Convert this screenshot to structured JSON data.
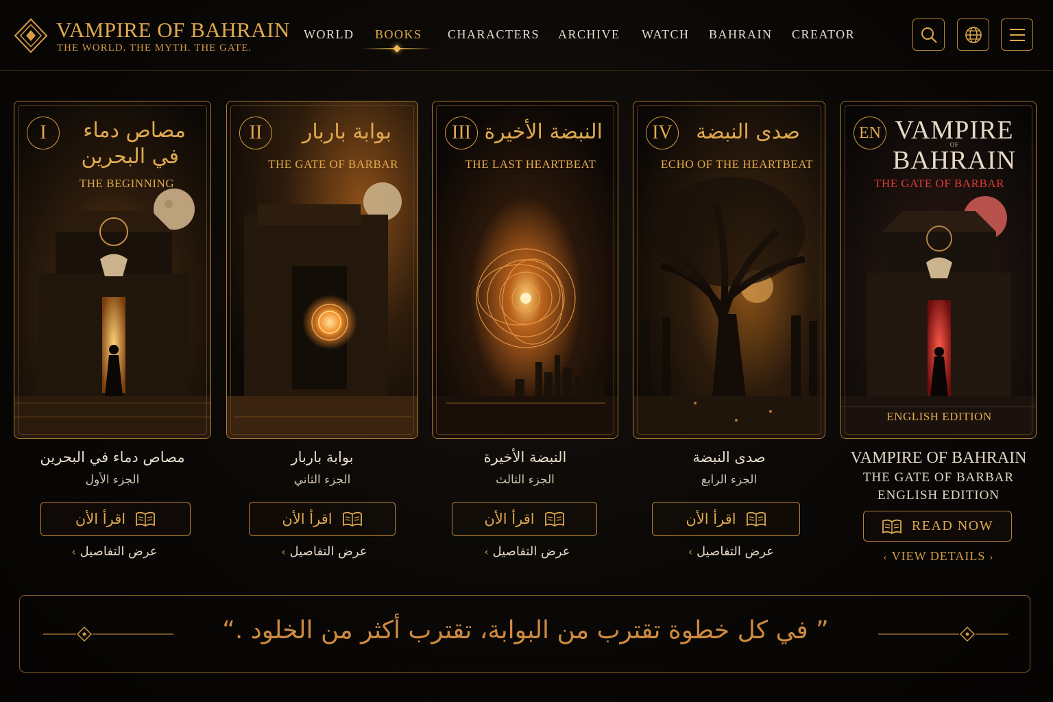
{
  "brand": {
    "title": "VAMPIRE OF BAHRAIN",
    "tagline": "THE WORLD. THE MYTH. THE GATE."
  },
  "nav": {
    "items": [
      {
        "label": "WORLD"
      },
      {
        "label": "BOOKS",
        "active": true
      },
      {
        "label": "CHARACTERS"
      },
      {
        "label": "ARCHIVE"
      },
      {
        "label": "WATCH"
      },
      {
        "label": "BAHRAIN"
      },
      {
        "label": "CREATOR"
      }
    ],
    "icons": [
      "search-icon",
      "globe-icon",
      "menu-icon"
    ]
  },
  "books": [
    {
      "numeral": "I",
      "cover_ar_line1": "مصاص دماء",
      "cover_ar_line2": "في البحرين",
      "cover_en": "THE BEGINNING",
      "title": "مصاص دماء في البحرين",
      "part": "الجزء الأول",
      "read_label": "اقرأ الأن",
      "details_label": "عرض التفاصيل"
    },
    {
      "numeral": "II",
      "cover_ar_line1": "بوابة باربار",
      "cover_en": "THE GATE OF BARBAR",
      "title": "بوابة باربار",
      "part": "الجزء الثاني",
      "read_label": "اقرأ الأن",
      "details_label": "عرض التفاصيل"
    },
    {
      "numeral": "III",
      "cover_ar_line1": "النبضة الأخيرة",
      "cover_en": "THE LAST HEARTBEAT",
      "title": "النبضة الأخيرة",
      "part": "الجزء الثالث",
      "read_label": "اقرأ الأن",
      "details_label": "عرض التفاصيل"
    },
    {
      "numeral": "IV",
      "cover_ar_line1": "صدى النبضة",
      "cover_en": "ECHO OF THE HEARTBEAT",
      "title": "صدى النبضة",
      "part": "الجزء الرابع",
      "read_label": "اقرأ الأن",
      "details_label": "عرض التفاصيل"
    },
    {
      "numeral": "EN",
      "cover_en_line1": "VAMPIRE",
      "cover_of": "OF",
      "cover_en_line2": "BAHRAIN",
      "cover_subtitle": "THE GATE OF BARBAR",
      "cover_edition": "ENGLISH EDITION",
      "title": "VAMPIRE OF BAHRAIN",
      "subtitle": "THE GATE OF BARBAR",
      "edition": "ENGLISH EDITION",
      "read_label": "READ NOW",
      "details_label": "VIEW DETAILS"
    }
  ],
  "quote": "” في كل خطوة تقترب من البوابة، تقترب أكثر من الخلود .“",
  "colors": {
    "gold": "#e0a94e",
    "background": "#0a0806",
    "red_accent": "#d4262a"
  }
}
